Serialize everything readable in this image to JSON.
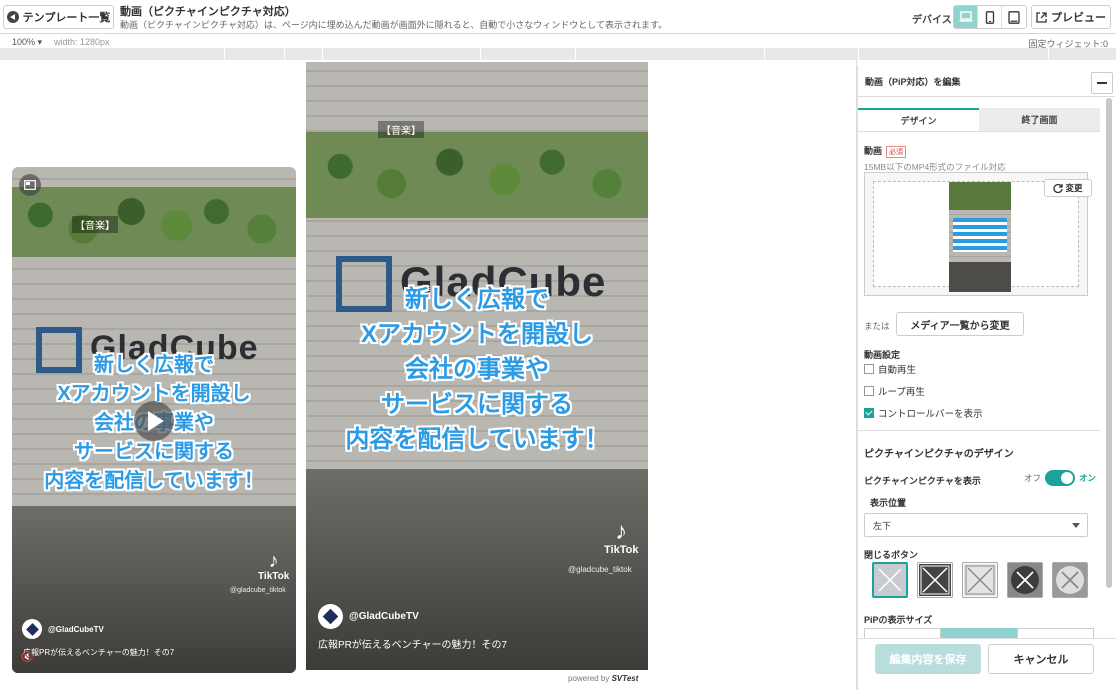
{
  "topbar": {
    "back_label": "テンプレート一覧",
    "title": "動画（ピクチャインピクチャ対応）",
    "description": "動画（ピクチャインピクチャ対応）は、ページ内に埋め込んだ動画が画面外に隠れると、自動で小さなウィンドウとして表示されます。",
    "device_label": "デバイス",
    "preview_label": "プレビュー"
  },
  "subbar": {
    "zoom": "100%",
    "width": "width: 1280px",
    "widget_count": "固定ウィジェット:0"
  },
  "videos": {
    "pip": {
      "music_tag": "【音楽】",
      "caption": [
        "新しく広報で",
        "Xアカウントを開設し",
        "会社の事業や",
        "サービスに関する",
        "内容を配信しています！"
      ],
      "logo": "GladCube",
      "tiktok": "TikTok",
      "handle": "@gladcube_tiktok",
      "channel": "@GladCubeTV",
      "title": "広報PRが伝えるベンチャーの魅力！その7"
    },
    "main": {
      "music_tag": "【音楽】",
      "caption": [
        "新しく広報で",
        "Xアカウントを開設し",
        "会社の事業や",
        "サービスに関する",
        "内容を配信しています！"
      ],
      "logo": "GladCube",
      "tiktok": "TikTok",
      "handle": "@gladcube_tiktok",
      "channel": "@GladCubeTV",
      "title": "広報PRが伝えるベンチャーの魅力！その7"
    },
    "powered_by": "powered by",
    "brand": "SVTest"
  },
  "panel": {
    "header": "動画（PiP対応）を編集",
    "tabs": [
      "デザイン",
      "終了画面"
    ],
    "video_label": "動画",
    "required": "必須",
    "file_note": "15MB以下のMP4形式のファイル対応",
    "change_label": "変更",
    "or_label": "または",
    "media_button": "メディア一覧から変更",
    "settings_label": "動画設定",
    "autoplay": "自動再生",
    "loop": "ループ再生",
    "controls": "コントロールバーを表示",
    "pip_section": "ピクチャインピクチャのデザイン",
    "pip_show": "ピクチャインピクチャを表示",
    "toggle_off": "オフ",
    "toggle_on": "オン",
    "position_label": "表示位置",
    "position_value": "左下",
    "close_button_label": "閉じるボタン",
    "size_label": "PiPの表示サイズ",
    "save": "編集内容を保存",
    "cancel": "キャンセル",
    "accent": "#1aa39a"
  }
}
